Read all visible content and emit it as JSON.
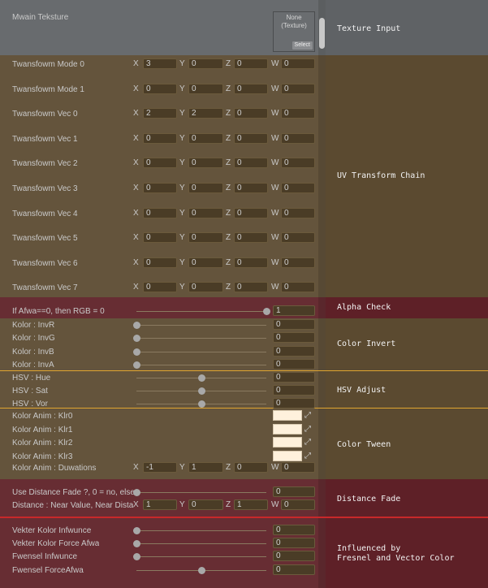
{
  "texture": {
    "label": "Mwain Teksture",
    "slot_text_1": "None",
    "slot_text_2": "(Texture)",
    "select_label": "Select"
  },
  "transform_rows": [
    {
      "label": "Twansfowm Mode 0",
      "x": "3",
      "y": "0",
      "z": "0",
      "w": "0"
    },
    {
      "label": "Twansfowm Mode 1",
      "x": "0",
      "y": "0",
      "z": "0",
      "w": "0"
    },
    {
      "label": "Twansfowm Vec 0",
      "x": "2",
      "y": "2",
      "z": "0",
      "w": "0"
    },
    {
      "label": "Twansfowm Vec 1",
      "x": "0",
      "y": "0",
      "z": "0",
      "w": "0"
    },
    {
      "label": "Twansfowm Vec 2",
      "x": "0",
      "y": "0",
      "z": "0",
      "w": "0"
    },
    {
      "label": "Twansfowm Vec 3",
      "x": "0",
      "y": "0",
      "z": "0",
      "w": "0"
    },
    {
      "label": "Twansfowm Vec 4",
      "x": "0",
      "y": "0",
      "z": "0",
      "w": "0"
    },
    {
      "label": "Twansfowm Vec 5",
      "x": "0",
      "y": "0",
      "z": "0",
      "w": "0"
    },
    {
      "label": "Twansfowm Vec 6",
      "x": "0",
      "y": "0",
      "z": "0",
      "w": "0"
    },
    {
      "label": "Twansfowm Vec 7",
      "x": "0",
      "y": "0",
      "z": "0",
      "w": "0"
    }
  ],
  "axis_labels": {
    "x": "X",
    "y": "Y",
    "z": "Z",
    "w": "W"
  },
  "alpha": {
    "label": "If Afwa==0, then RGB = 0",
    "value": "1",
    "fraction": 1.0
  },
  "invert": [
    {
      "label": "Kolor : InvR",
      "value": "0",
      "fraction": 0
    },
    {
      "label": "Kolor : InvG",
      "value": "0",
      "fraction": 0
    },
    {
      "label": "Kolor : InvB",
      "value": "0",
      "fraction": 0
    },
    {
      "label": "Kolor : InvA",
      "value": "0",
      "fraction": 0
    }
  ],
  "hsv": [
    {
      "label": "HSV : Hue",
      "value": "0",
      "fraction": 0.5
    },
    {
      "label": "HSV : Sat",
      "value": "0",
      "fraction": 0.5
    },
    {
      "label": "HSV : Vor",
      "value": "0",
      "fraction": 0.5
    }
  ],
  "tween": {
    "colors": [
      {
        "label": "Kolor Anim : Klr0"
      },
      {
        "label": "Kolor Anim : Klr1"
      },
      {
        "label": "Kolor Anim : Klr2"
      },
      {
        "label": "Kolor Anim : Klr3"
      }
    ],
    "durations": {
      "label": "Kolor Anim : Duwations",
      "x": "-1",
      "y": "1",
      "z": "0",
      "w": "0"
    },
    "swatch_color": "#fff1dc",
    "picker_glyph": "⤢"
  },
  "distance": {
    "fade": {
      "label": "Use Distance Fade ?, 0 = no, else",
      "value": "0",
      "fraction": 0
    },
    "values": {
      "label": "Distance : Near Value, Near Dista",
      "x": "1",
      "y": "0",
      "z": "1",
      "w": "0"
    }
  },
  "influence": [
    {
      "label": "Vekter Kolor Infwunce",
      "value": "0",
      "fraction": 0
    },
    {
      "label": "Vekter Kolor Force Afwa",
      "value": "0",
      "fraction": 0
    },
    {
      "label": "Fwensel Infwunce",
      "value": "0",
      "fraction": 0
    },
    {
      "label": "Fwensel ForceAfwa",
      "value": "0",
      "fraction": 0.5
    }
  ],
  "regions": {
    "texture_input": "Texture Input",
    "uv_transform": "UV Transform Chain",
    "alpha_check": "Alpha Check",
    "color_invert": "Color Invert",
    "hsv_adjust": "HSV Adjust",
    "color_tween": "Color Tween",
    "distance_fade": "Distance Fade",
    "influenced_1": "Influenced by",
    "influenced_2": "Fresnel and Vector Color"
  },
  "colors": {
    "texture_bg": "#5f6265",
    "brown": "#5b4a30",
    "alpha_bg": "#5e2027",
    "distance_bg": "#5e2027",
    "influence_bg": "#5e2027",
    "sep_gold": "#e0a530",
    "sep_red": "#c8282a",
    "panel_right": "#5e4b30"
  }
}
